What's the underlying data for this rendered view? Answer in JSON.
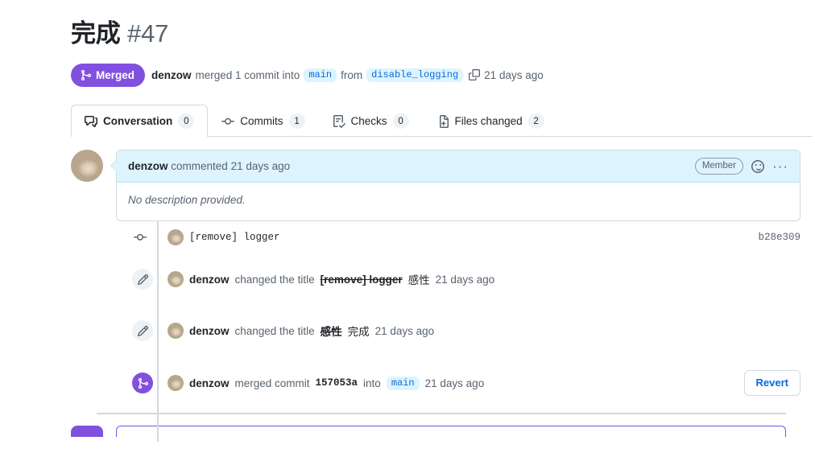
{
  "header": {
    "title": "完成",
    "number": "#47"
  },
  "state": {
    "badge_label": "Merged",
    "badge_icon": "git-merge-icon",
    "badge_color": "#8250df",
    "actor": "denzow",
    "action_text": "merged 1 commit into",
    "base_branch": "main",
    "from_text": "from",
    "head_branch": "disable_logging",
    "copy_icon": "copy-icon",
    "timestamp": "21 days ago"
  },
  "tabs": [
    {
      "label": "Conversation",
      "count": "0",
      "icon": "comment-discussion-icon",
      "active": true
    },
    {
      "label": "Commits",
      "count": "1",
      "icon": "git-commit-icon",
      "active": false
    },
    {
      "label": "Checks",
      "count": "0",
      "icon": "checklist-icon",
      "active": false
    },
    {
      "label": "Files changed",
      "count": "2",
      "icon": "file-diff-icon",
      "active": false
    }
  ],
  "comment": {
    "author": "denzow",
    "action": "commented",
    "timestamp": "21 days ago",
    "role_badge": "Member",
    "reaction_icon": "smiley-icon",
    "menu_icon": "kebab-horizontal-icon",
    "body": "No description provided."
  },
  "timeline": [
    {
      "type": "commit",
      "icon": "git-commit-icon",
      "message": "[remove] logger",
      "sha": "b28e309"
    },
    {
      "type": "title-change",
      "icon": "pencil-icon",
      "actor": "denzow",
      "action": "changed the title",
      "old_title": "[remove] logger",
      "new_title": "感性",
      "timestamp": "21 days ago"
    },
    {
      "type": "title-change",
      "icon": "pencil-icon",
      "actor": "denzow",
      "action": "changed the title",
      "old_title": "感性",
      "new_title": "完成",
      "timestamp": "21 days ago"
    },
    {
      "type": "merged",
      "icon": "git-merge-icon",
      "actor": "denzow",
      "action": "merged commit",
      "sha": "157053a",
      "into_text": "into",
      "branch": "main",
      "timestamp": "21 days ago",
      "button_label": "Revert"
    }
  ],
  "colors": {
    "merged_purple": "#8250df",
    "link_blue": "#0969da",
    "branch_bg": "#ddf4ff",
    "border_gray": "#d1d9e0",
    "muted_text": "#59636e"
  }
}
